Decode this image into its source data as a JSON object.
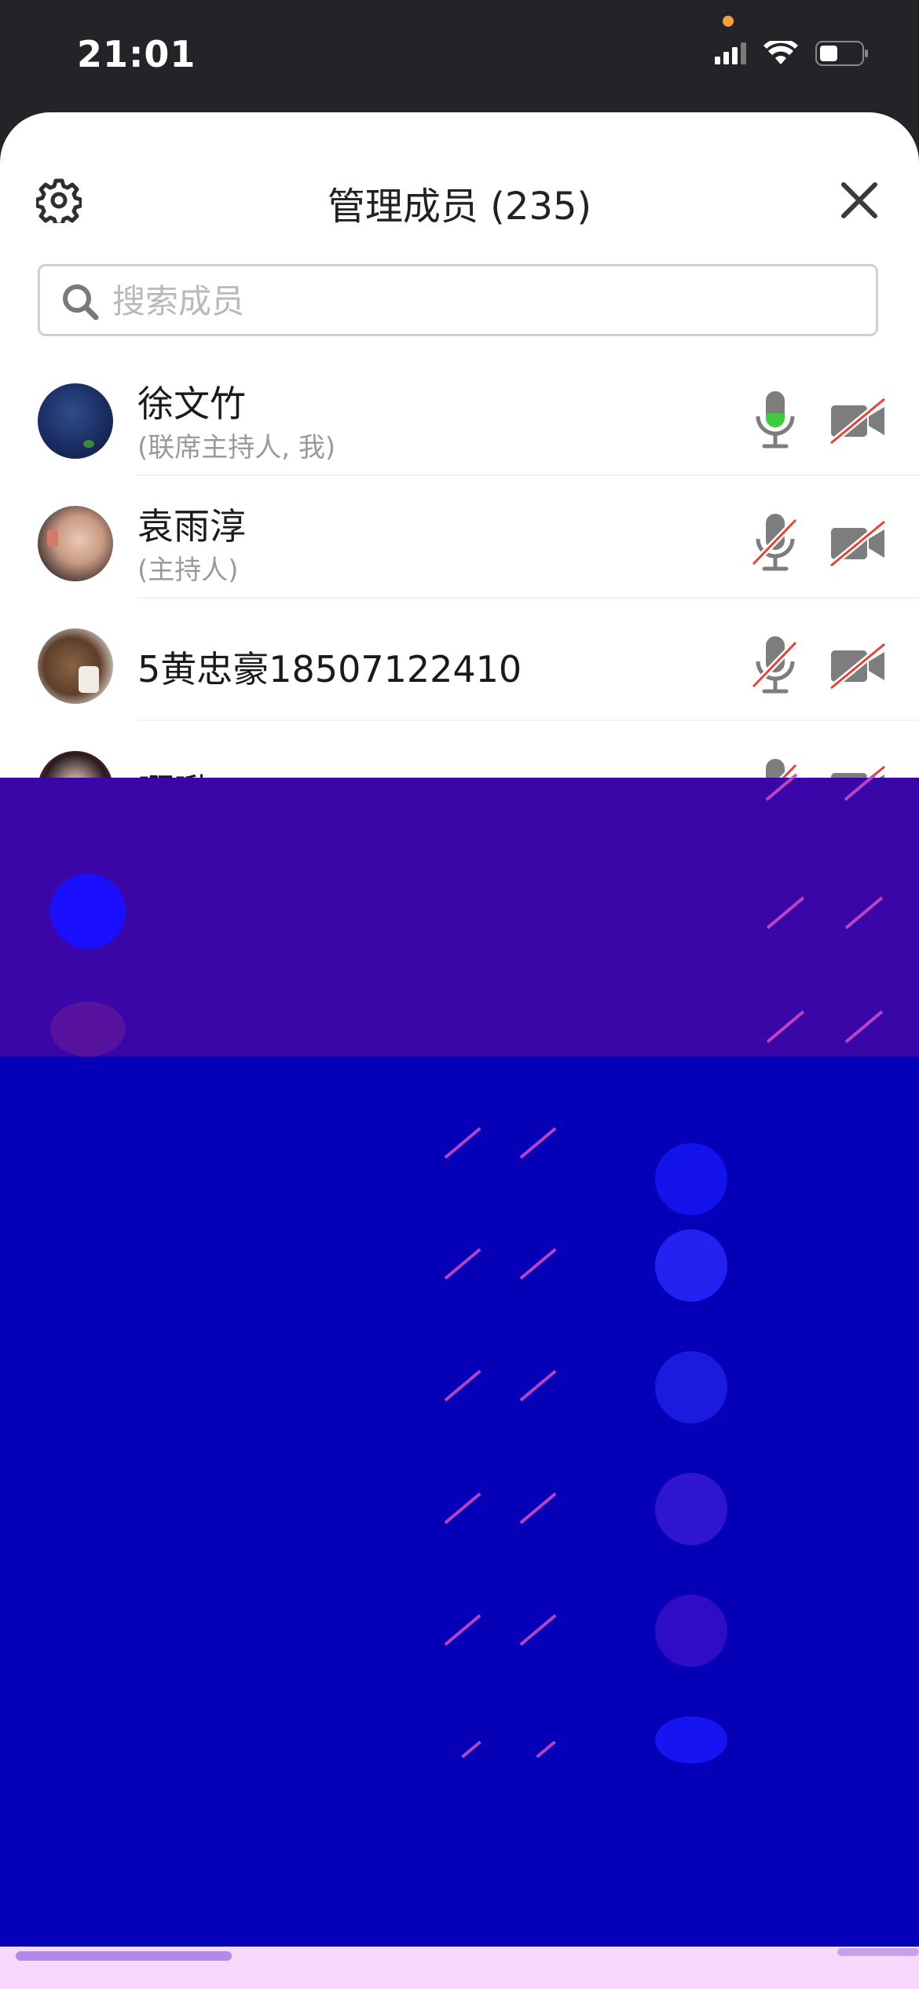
{
  "status_bar": {
    "time": "21:01",
    "icons": [
      "cellular-signal-icon",
      "wifi-icon",
      "battery-icon"
    ]
  },
  "sheet": {
    "title": "管理成员 (235)",
    "search_placeholder": "搜索成员"
  },
  "members": [
    {
      "name": "徐文竹",
      "role": "(联席主持人, 我)",
      "mic": "on",
      "camera": "off"
    },
    {
      "name": "袁雨淳",
      "role": "(主持人)",
      "mic": "off",
      "camera": "off"
    },
    {
      "name": "5黄忠豪18507122410",
      "role": "",
      "mic": "off",
      "camera": "off"
    },
    {
      "name": "啊啾",
      "role": "",
      "mic": "off",
      "camera": "off"
    }
  ],
  "colors": {
    "mic_on": "#3dcc3d",
    "muted_slash": "#e0443a",
    "icon_gray": "#7d7d7d",
    "overlay_purple": "#3a06a8",
    "overlay_blue": "#0500b8"
  }
}
